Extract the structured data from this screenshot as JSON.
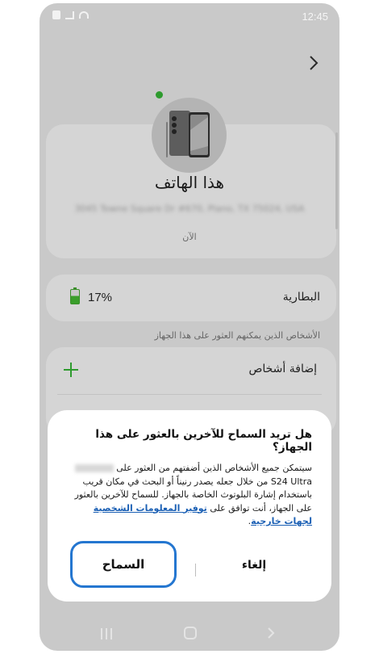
{
  "status_bar": {
    "time": "12:45",
    "icons": [
      "sim-icon",
      "signal-icon",
      "wifi-icon"
    ]
  },
  "device": {
    "name": "هذا الهاتف",
    "address": "3045 Towne Square Dr #670, Plano, TX 75024, USA",
    "last_seen": "الآن",
    "online_color": "#2e9b2e"
  },
  "battery": {
    "label": "البطارية",
    "value": "17%",
    "level": 0.17,
    "color": "#3a9e2b"
  },
  "people": {
    "section_header": "الأشخاص الذين يمكنهم العثور على هذا الجهاز",
    "add_label": "إضافة أشخاص"
  },
  "dialog": {
    "title": "هل تريد السماح للآخرين بالعثور على هذا الجهاز؟",
    "body_part1": "سيتمكن جميع الأشخاص الذين أضفتهم من العثور على",
    "device_model": "S24 Ultra",
    "body_part2": "من خلال جعله يصدر رنيناً أو البحث في مكان قريب باستخدام إشارة البلوتوث الخاصة بالجهاز. للسماح للآخرين بالعثور على الجهاز، أنت توافق على",
    "link_text": "توفير المعلومات الشخصية لجهات خارجية",
    "body_end": ".",
    "allow_label": "السماح",
    "cancel_label": "إلغاء",
    "accent_color": "#2476d0"
  },
  "nav": {
    "recent": "recent-apps-icon",
    "home": "home-icon",
    "back": "back-icon"
  }
}
